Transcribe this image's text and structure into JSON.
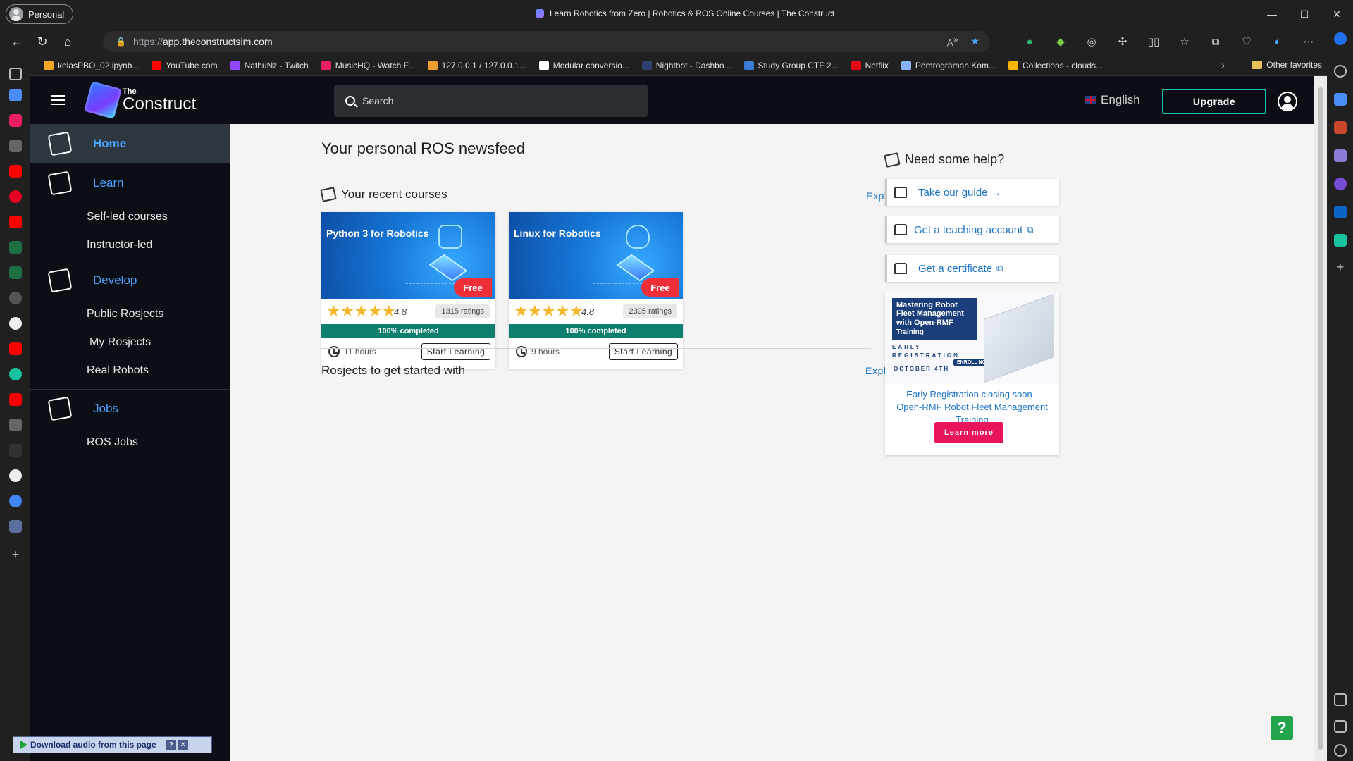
{
  "browser": {
    "profile": "Personal",
    "tab_title": "Learn Robotics from Zero | Robotics & ROS Online Courses | The Construct",
    "url_scheme": "https://",
    "url_host": "app.theconstructsim.com",
    "favorites": [
      {
        "label": "kelasPBO_02.ipynb...",
        "color": "#f5a623"
      },
      {
        "label": "YouTube com",
        "color": "#ff0000"
      },
      {
        "label": "NathuNz - Twitch",
        "color": "#9146ff"
      },
      {
        "label": "MusicHQ - Watch F...",
        "color": "#e91e63"
      },
      {
        "label": "127.0.0.1 / 127.0.0.1...",
        "color": "#f0a030"
      },
      {
        "label": "Modular conversio...",
        "color": "#ffffff"
      },
      {
        "label": "Nightbot - Dashbo...",
        "color": "#2f3f6f"
      },
      {
        "label": "Study Group CTF 2...",
        "color": "#3a7bd5"
      },
      {
        "label": "Netflix",
        "color": "#e50914"
      },
      {
        "label": "Pemrograman Kom...",
        "color": "#8ab4f8"
      },
      {
        "label": "Collections - clouds...",
        "color": "#f4b400"
      }
    ],
    "other_favorites": "Other favorites"
  },
  "header": {
    "logo_the": "The",
    "logo_name": "Construct",
    "search_placeholder": "Search",
    "language": "English",
    "upgrade": "Upgrade"
  },
  "sidebar": {
    "home": "Home",
    "learn": "Learn",
    "learn_items": [
      "Self-led courses",
      "Instructor-led"
    ],
    "develop": "Develop",
    "develop_items": [
      "Public Rosjects",
      "My Rosjects",
      "Real Robots"
    ],
    "jobs": "Jobs",
    "jobs_items": [
      "ROS Jobs"
    ]
  },
  "main": {
    "title": "Your personal ROS newsfeed",
    "recent_courses": "Your recent courses",
    "explore_courses": "Explore other courses",
    "courses": [
      {
        "title": "Python 3 for Robotics",
        "badge": "Free",
        "rating": "4.8",
        "ratings": "1315 ratings",
        "progress_pct": 100,
        "progress_label": "100% completed",
        "hours": "11 hours",
        "cta": "Start Learning"
      },
      {
        "title": "Linux for Robotics",
        "badge": "Free",
        "rating": "4.8",
        "ratings": "2395 ratings",
        "progress_pct": 100,
        "progress_label": "100% completed",
        "hours": "9 hours",
        "cta": "Start Learning"
      }
    ],
    "rosjects_title": "Rosjects to get started with",
    "explore_rosjects": "Explore other rosjects"
  },
  "help": {
    "title": "Need some help?",
    "items": [
      {
        "label": "Take our guide",
        "suffix": "→"
      },
      {
        "label": "Get a teaching account",
        "suffix": "⧉"
      },
      {
        "label": "Get a certificate",
        "suffix": "⧉"
      }
    ]
  },
  "promo": {
    "banner_title": "Mastering Robot Fleet Management with Open-RMF",
    "banner_sub": "Training",
    "early_line1": "EARLY",
    "early_line2": "REGISTRATION",
    "date": "OCTOBER 4TH",
    "enroll": "ENROLL NOW",
    "text": "Early Registration closing soon - Open-RMF Robot Fleet Management Training",
    "button": "Learn more"
  },
  "help_button": "?",
  "download_bar": "Download audio from this page",
  "colors": {
    "accent": "#4aa3ff",
    "upgrade_border": "#19c3b6",
    "free_badge": "#ee2f3a",
    "progress": "#0f7f6d",
    "learn_more": "#e9155c"
  }
}
